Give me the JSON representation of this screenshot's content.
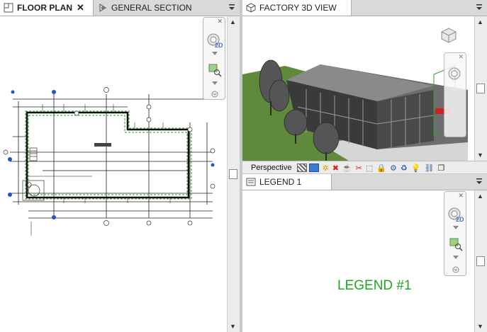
{
  "left_pane": {
    "tabs": [
      {
        "label": "FLOOR PLAN",
        "active": true,
        "close": "✕"
      },
      {
        "label": "GENERAL SECTION",
        "active": false
      }
    ]
  },
  "right_top_pane": {
    "tab": {
      "label": "FACTORY 3D VIEW"
    },
    "status": {
      "view_mode": "Perspective"
    }
  },
  "right_bottom_pane": {
    "tab": {
      "label": "LEGEND 1"
    },
    "legend_text": "LEGEND #1"
  },
  "navbar": {
    "label_2d": "2D"
  },
  "colors": {
    "legend_green": "#1fa51f",
    "grass": "#5f8a3c",
    "plan_line": "#111111",
    "plan_green": "#2e9b2e",
    "grid_blue": "#2255cc"
  }
}
